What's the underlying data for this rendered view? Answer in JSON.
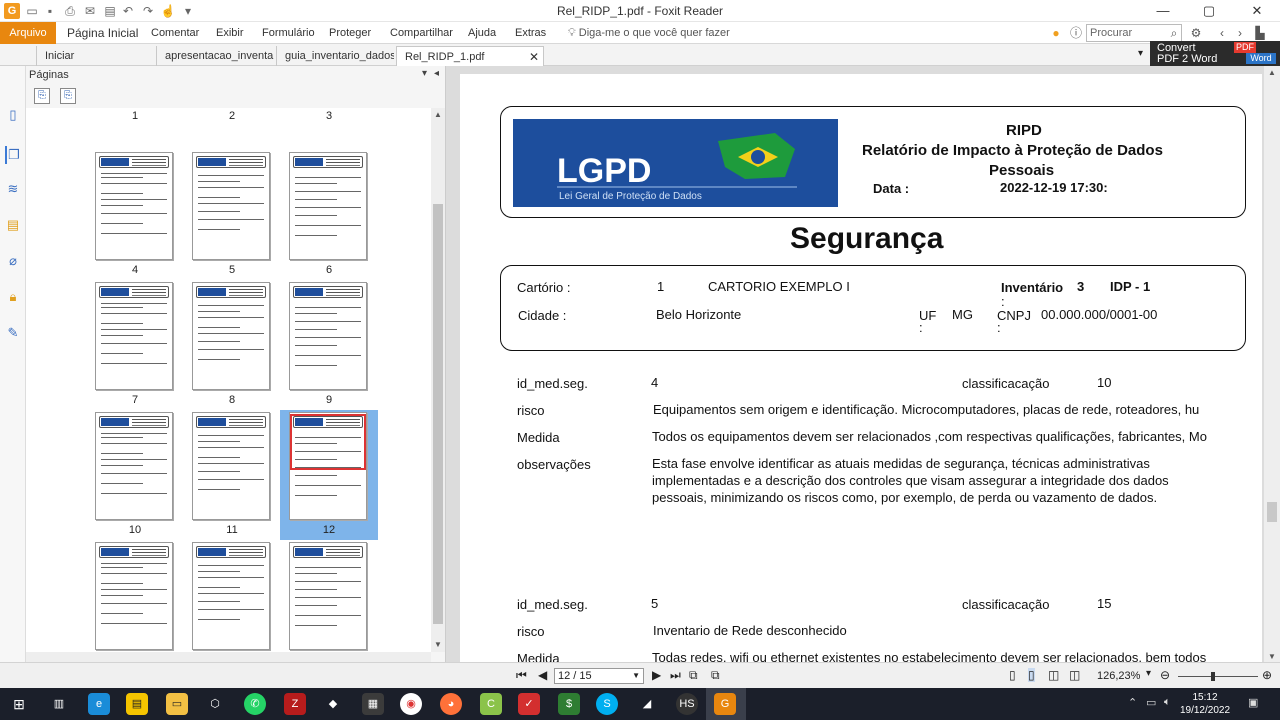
{
  "window": {
    "title": "Rel_RIDP_1.pdf - Foxit Reader"
  },
  "ribbon": {
    "file_tab": "Arquivo",
    "tabs": [
      "Página Inicial",
      "Comentar",
      "Exibir",
      "Formulário",
      "Proteger",
      "Compartilhar",
      "Ajuda",
      "Extras"
    ],
    "tell_me": "Diga-me o que você quer fazer",
    "search_placeholder": "Procurar"
  },
  "doc_tabs": [
    "Iniciar",
    "apresentacao_inventa...",
    "guia_inventario_dados...",
    "Rel_RIDP_1.pdf"
  ],
  "convert": {
    "line1": "Convert",
    "line2": "PDF 2 Word",
    "badge_pdf": "PDF",
    "badge_word": "Word"
  },
  "panel": {
    "title": "Páginas"
  },
  "thumbnails": [
    "1",
    "2",
    "3",
    "4",
    "5",
    "6",
    "7",
    "8",
    "9",
    "10",
    "11",
    "12",
    "",
    "",
    ""
  ],
  "selected_page": "12",
  "document": {
    "header": {
      "logo_text": "LGPD",
      "logo_subtitle": "Lei Geral de Proteção de Dados",
      "acronym": "RIPD",
      "title_line1": "Relatório de Impacto à Proteção de Dados",
      "title_line2": "Pessoais",
      "date_label": "Data :",
      "date_value": "2022-12-19 17:30:"
    },
    "section_title": "Segurança",
    "info": {
      "cartorio_label": "Cartório :",
      "cartorio_num": "1",
      "cartorio_name": "CARTORIO EXEMPLO I",
      "inventario_label": "Inventário",
      "inventario_colon": ":",
      "inventario_value": "3",
      "idp": "IDP - 1",
      "cidade_label": "Cidade :",
      "cidade_value": "Belo Horizonte",
      "uf_label": "UF",
      "uf_colon": ":",
      "uf_value": "MG",
      "cnpj_label": "CNPJ",
      "cnpj_colon": ":",
      "cnpj_value": "00.000.000/0001-00"
    },
    "records": [
      {
        "id_label": "id_med.seg.",
        "id_value": "4",
        "class_label": "classificacação",
        "class_value": "10",
        "risco_label": "risco",
        "risco_value": "Equipamentos sem origem e identificação.  Microcomputadores, placas de rede, roteadores, hu",
        "medida_label": "Medida",
        "medida_value": "Todos os equipamentos devem ser relacionados ,com respectivas qualificações, fabricantes, Mo",
        "obs_label": "observações",
        "obs_lines": [
          "Esta fase envolve identificar as atuais medidas de segurança, técnicas administrativas",
          "implementadas e a descrição dos controles que visam assegurar a integridade dos dados",
          "pessoais, minimizando os riscos como, por exemplo, de perda ou vazamento de dados."
        ]
      },
      {
        "id_label": "id_med.seg.",
        "id_value": "5",
        "class_label": "classificacação",
        "class_value": "15",
        "risco_label": "risco",
        "risco_value": "Inventario de Rede desconhecido",
        "medida_label": "Medida",
        "medida_value": "Todas redes, wifi ou ethernet existentes no estabelecimento devem ser relacionados, bem todos"
      }
    ]
  },
  "status": {
    "page_box": "12 / 15",
    "zoom": "126,23%"
  },
  "taskbar": {
    "time": "15:12",
    "date": "19/12/2022"
  },
  "colors": {
    "accent": "#e8870f",
    "selection": "#7eb4ea",
    "logo_blue": "#1d4e9d"
  }
}
